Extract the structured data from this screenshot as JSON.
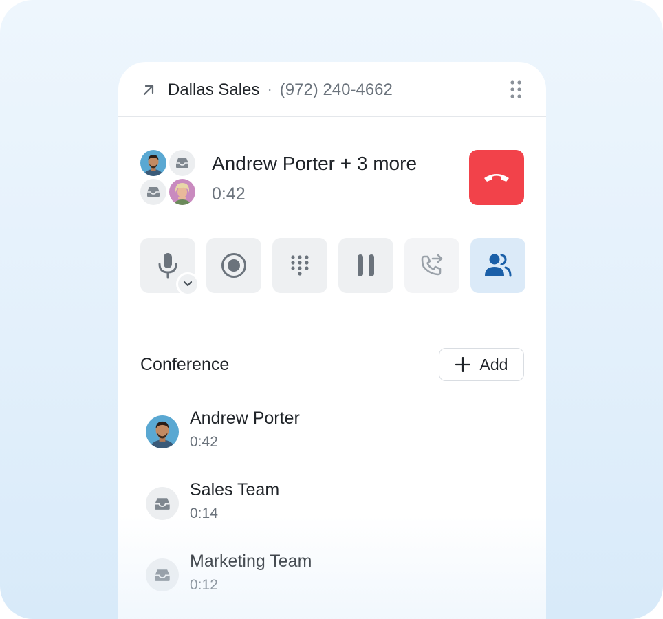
{
  "header": {
    "name": "Dallas Sales",
    "separator": "·",
    "phone": "(972) 240-4662"
  },
  "call": {
    "title": "Andrew Porter + 3 more",
    "timer": "0:42"
  },
  "controls": [
    {
      "id": "mute",
      "icon": "microphone-icon"
    },
    {
      "id": "record",
      "icon": "record-icon"
    },
    {
      "id": "keypad",
      "icon": "keypad-icon"
    },
    {
      "id": "hold",
      "icon": "pause-icon"
    },
    {
      "id": "transfer",
      "icon": "phone-transfer-icon",
      "state": "disabled"
    },
    {
      "id": "participants",
      "icon": "users-icon",
      "state": "active"
    }
  ],
  "conference": {
    "title": "Conference",
    "add_label": "Add",
    "participants": [
      {
        "name": "Andrew Porter",
        "time": "0:42",
        "avatar": "photo"
      },
      {
        "name": "Sales Team",
        "time": "0:14",
        "avatar": "inbox-icon"
      },
      {
        "name": "Marketing Team",
        "time": "0:12",
        "avatar": "inbox-icon"
      }
    ]
  },
  "colors": {
    "hangup": "#f2424a",
    "active_control_bg": "#dbeaf8",
    "active_icon": "#1a5fa8",
    "icon_gray": "#6b737c"
  }
}
